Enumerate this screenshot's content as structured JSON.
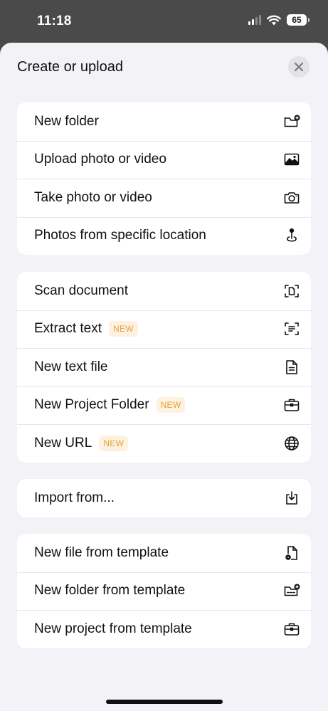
{
  "status_bar": {
    "time": "11:18",
    "battery": "65"
  },
  "sheet": {
    "title": "Create or upload"
  },
  "groups": [
    {
      "items": [
        {
          "label": "New folder",
          "icon": "new-folder-icon"
        },
        {
          "label": "Upload photo or video",
          "icon": "image-icon"
        },
        {
          "label": "Take photo or video",
          "icon": "camera-icon"
        },
        {
          "label": "Photos from specific location",
          "icon": "location-pin-icon"
        }
      ]
    },
    {
      "items": [
        {
          "label": "Scan document",
          "icon": "scan-document-icon"
        },
        {
          "label": "Extract text",
          "badge": "NEW",
          "icon": "extract-text-icon"
        },
        {
          "label": "New text file",
          "icon": "text-file-icon"
        },
        {
          "label": "New Project Folder",
          "badge": "NEW",
          "icon": "briefcase-icon"
        },
        {
          "label": "New URL",
          "badge": "NEW",
          "icon": "globe-icon"
        }
      ]
    },
    {
      "items": [
        {
          "label": "Import from...",
          "icon": "import-icon"
        }
      ]
    },
    {
      "items": [
        {
          "label": "New file from template",
          "icon": "file-template-icon"
        },
        {
          "label": "New folder from template",
          "icon": "folder-template-icon"
        },
        {
          "label": "New project from template",
          "icon": "briefcase-icon"
        }
      ]
    }
  ],
  "colors": {
    "badge_bg": "#fdf1df",
    "badge_text": "#e8a13a",
    "sheet_bg": "#f2f2f7"
  }
}
